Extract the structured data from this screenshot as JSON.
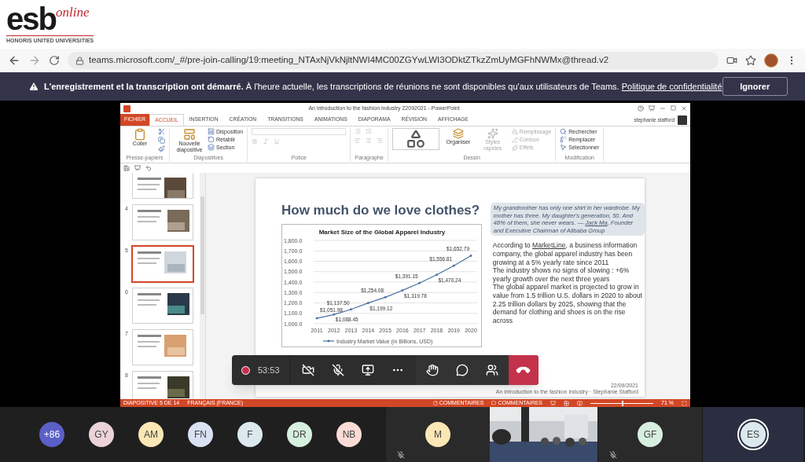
{
  "logo": {
    "brand": "esb",
    "tagline": "online",
    "subtitle": "HONORIS UNITED UNIVERSITIES"
  },
  "browser": {
    "url": "teams.microsoft.com/_#/pre-join-calling/19:meeting_NTAxNjVkNjltNWI4MC00ZGYwLWI3ODktZTkzZmUyMGFhNWMx@thread.v2"
  },
  "banner": {
    "bold": "L'enregistrement et la transcription ont démarré.",
    "text": "À l'heure actuelle, les transcriptions de réunions ne sont disponibles qu'aux utilisateurs de Teams.",
    "link": "Politique de confidentialité",
    "button": "Ignorer"
  },
  "powerpoint": {
    "title": "An introduction to the fashion industry 22092021 - PowerPoint",
    "user": "stephanie stafford",
    "tabs": [
      {
        "label": "FICHIER",
        "kind": "file",
        "selected": false
      },
      {
        "label": "ACCUEIL",
        "kind": "tab",
        "selected": true
      },
      {
        "label": "INSERTION",
        "kind": "tab",
        "selected": false
      },
      {
        "label": "CRÉATION",
        "kind": "tab",
        "selected": false
      },
      {
        "label": "TRANSITIONS",
        "kind": "tab",
        "selected": false
      },
      {
        "label": "ANIMATIONS",
        "kind": "tab",
        "selected": false
      },
      {
        "label": "DIAPORAMA",
        "kind": "tab",
        "selected": false
      },
      {
        "label": "RÉVISION",
        "kind": "tab",
        "selected": false
      },
      {
        "label": "AFFICHAGE",
        "kind": "tab",
        "selected": false
      }
    ],
    "ribbon": [
      {
        "kind": "clipboard",
        "label": "Presse-papiers",
        "buttons": [
          {
            "label": "Coller",
            "disabled": false
          }
        ]
      },
      {
        "kind": "slides",
        "label": "Diapositives",
        "buttons": [
          {
            "label": "Nouvelle diapositive",
            "disabled": false
          },
          {
            "label": "Disposition",
            "disabled": false
          },
          {
            "label": "Rétablir",
            "disabled": false
          },
          {
            "label": "Section",
            "disabled": false
          }
        ]
      },
      {
        "kind": "font",
        "label": "Police"
      },
      {
        "kind": "paragraph",
        "label": "Paragraphe"
      },
      {
        "kind": "drawing",
        "label": "Dessin",
        "buttons": [
          {
            "label": "Organiser",
            "disabled": false
          },
          {
            "label": "Styles rapides",
            "disabled": true
          },
          {
            "label": "Remplissage",
            "disabled": true
          },
          {
            "label": "Contour",
            "disabled": true
          },
          {
            "label": "Effets",
            "disabled": true
          }
        ]
      },
      {
        "kind": "editing",
        "label": "Modification",
        "buttons": [
          {
            "label": "Rechercher",
            "disabled": false
          },
          {
            "label": "Remplacer",
            "disabled": false
          },
          {
            "label": "Sélectionner",
            "disabled": false
          }
        ]
      }
    ],
    "thumbnails": [
      {
        "selected": false
      },
      {
        "number": "4",
        "selected": false
      },
      {
        "number": "5",
        "selected": true
      },
      {
        "number": "6",
        "selected": false
      },
      {
        "number": "7",
        "selected": false
      },
      {
        "number": "8",
        "selected": false
      }
    ],
    "slide": {
      "title": "How much do we love clothes?",
      "chart_data": {
        "type": "line",
        "title": "Market Size of the Global Apparel Industry",
        "categories": [
          "2011",
          "2012",
          "2013",
          "2014",
          "2015",
          "2016",
          "2017",
          "2018",
          "2019",
          "2020"
        ],
        "series": [
          {
            "name": "Industry Market Value (in Billions, USD)",
            "color": "#4a6fa5",
            "values": [
              1052,
              1088,
              1138,
              1199,
              1254,
              1320,
              1391,
              1470,
              1557,
              1653
            ]
          }
        ],
        "value_labels": [
          "$1,051.98",
          "$1,088.45",
          "$1,137.50",
          "$1,199.12",
          "$1,254.08",
          "$1,319.78",
          "$1,391.15",
          "$1,470.24",
          "$1,556.81",
          "$1,652.79"
        ],
        "grid": true,
        "ylim": [
          1000,
          1800
        ],
        "yticks": [
          {
            "value": 1000,
            "label": "1,000.0"
          },
          {
            "value": 1100,
            "label": "1,100.0"
          },
          {
            "value": 1200,
            "label": "1,200.0"
          },
          {
            "value": 1300,
            "label": "1,300.0"
          },
          {
            "value": 1400,
            "label": "1,400.0"
          },
          {
            "value": 1500,
            "label": "1,500.0"
          },
          {
            "value": 1600,
            "label": "1,600.0"
          },
          {
            "value": 1700,
            "label": "1,700.0"
          },
          {
            "value": 1800,
            "label": "1,800.0"
          }
        ],
        "stacked": false
      },
      "quote": "My grandmother has only one shirt in her wardrobe. My mother has three. My daughter's generation, 50. And 48% of them, she never wears. —",
      "quote_link": "Jack Ma",
      "quote_end": ", Founder and Executive Chairman of Alibaba Group",
      "body": [
        {
          "before": "According to ",
          "link": "MarketLine",
          "after": ", a business information company, the global apparel industry has been growing at a 5% yearly rate since 2011"
        },
        {
          "before": "The industry shows no signs of slowing : +6% yearly growth over the next three years"
        },
        {
          "before": "The global apparel market is projected to grow in value from 1.5 trillion U.S. dollars in 2020 to about 2.25 trillion dollars by 2025, showing that the demand for clothing and shoes is on the rise across"
        }
      ],
      "date": "22/09/2021",
      "footer": "An introduction to the fashion industry · Stephanie Stafford"
    },
    "status": {
      "slide": "DIAPOSITIVE 5 DE 14",
      "language": "FRANÇAIS (FRANCE)",
      "notes": "COMMENTAIRES",
      "comments": "COMMENTAIRES",
      "zoom": "71 %",
      "level": 0.5
    }
  },
  "call_controls": {
    "timer": "53:53",
    "recording": true,
    "camera_on": false,
    "mic_on": false
  },
  "participants": [
    {
      "kind": "overflow",
      "initials": "+86",
      "color": "#5b5fc7"
    },
    {
      "kind": "avatar",
      "initials": "GY",
      "color": "#ecd3d8"
    },
    {
      "kind": "avatar",
      "initials": "AM",
      "color": "#fbe7b5"
    },
    {
      "kind": "avatar",
      "initials": "FN",
      "color": "#d9e2f3"
    },
    {
      "kind": "avatar",
      "initials": "F",
      "color": "#dbe9ef"
    },
    {
      "kind": "avatar",
      "initials": "DR",
      "color": "#d7efdf"
    },
    {
      "kind": "avatar",
      "initials": "NB",
      "color": "#fbdcd5"
    },
    {
      "kind": "tile",
      "initials": "M",
      "color": "#fbe7b5",
      "muted": true,
      "speaking": false
    },
    {
      "kind": "video"
    },
    {
      "kind": "tile",
      "initials": "GF",
      "color": "#d7efdf",
      "muted": true,
      "speaking": false
    },
    {
      "kind": "tile",
      "initials": "ES",
      "color": "#dbe9ef",
      "muted": false,
      "speaking": true
    }
  ]
}
